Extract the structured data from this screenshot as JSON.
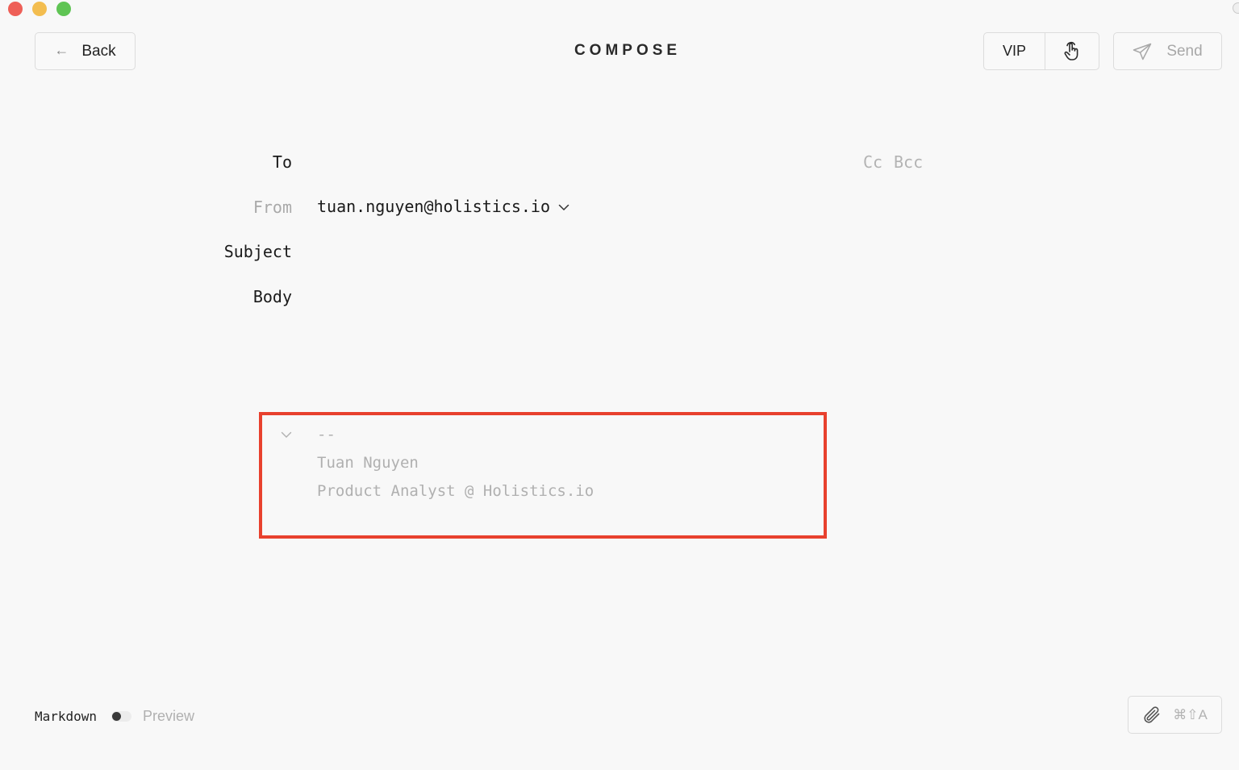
{
  "window": {
    "title": "COMPOSE"
  },
  "toolbar": {
    "back_label": "Back",
    "back_icon": "arrow-left-icon",
    "vip_label": "VIP",
    "gesture_icon": "hand-pointer-icon",
    "send_label": "Send",
    "send_icon": "paper-plane-icon"
  },
  "form": {
    "to_label": "To",
    "cc_label": "Cc",
    "bcc_label": "Bcc",
    "from_label": "From",
    "from_value": "tuan.nguyen@holistics.io",
    "subject_label": "Subject",
    "body_label": "Body"
  },
  "signature": {
    "separator": "--",
    "name": "Tuan Nguyen",
    "role": "Product Analyst @ Holistics.io",
    "highlight_color": "#e8412e"
  },
  "footer": {
    "markdown_label": "Markdown",
    "preview_label": "Preview",
    "attach_shortcut": "⌘⇧A",
    "attach_icon": "paperclip-icon"
  }
}
